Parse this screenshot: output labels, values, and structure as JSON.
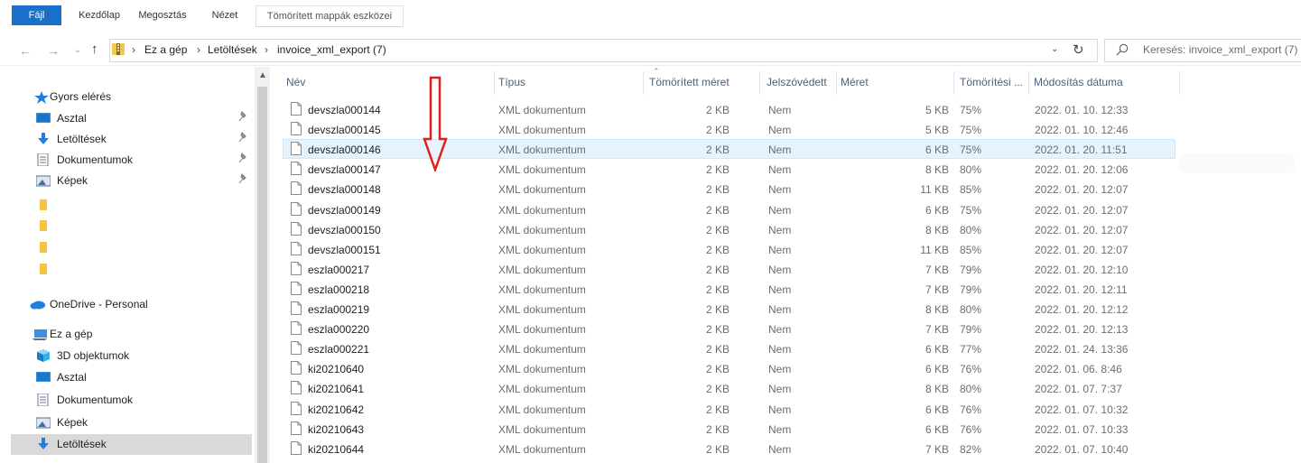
{
  "ribbon": {
    "tabs": [
      "Fájl",
      "Kezdőlap",
      "Megosztás",
      "Nézet"
    ],
    "context_tab": "Tömörített mappák eszközei",
    "file_tab_color": "#1a6fc9"
  },
  "address": {
    "crumbs": [
      "Ez a gép",
      "Letöltések",
      "invoice_xml_export (7)"
    ],
    "search_placeholder": "Keresés: invoice_xml_export (7)"
  },
  "nav": {
    "quick_access": "Gyors elérés",
    "items": [
      {
        "label": "Asztal",
        "icon": "desktop-icon",
        "pinned": true
      },
      {
        "label": "Letöltések",
        "icon": "download-icon",
        "pinned": true
      },
      {
        "label": "Dokumentumok",
        "icon": "documents-icon",
        "pinned": true
      },
      {
        "label": "Képek",
        "icon": "pictures-icon",
        "pinned": true
      },
      {
        "label": "",
        "icon": "folder-icon"
      },
      {
        "label": "",
        "icon": "folder-icon"
      },
      {
        "label": "",
        "icon": "folder-icon"
      },
      {
        "label": "",
        "icon": "folder-icon"
      }
    ],
    "onedrive": "OneDrive - Personal",
    "this_pc": "Ez a gép",
    "pc_items": [
      {
        "label": "3D objektumok",
        "icon": "3d-objects-icon"
      },
      {
        "label": "Asztal",
        "icon": "desktop-icon"
      },
      {
        "label": "Dokumentumok",
        "icon": "documents-icon"
      },
      {
        "label": "Képek",
        "icon": "pictures-icon"
      },
      {
        "label": "Letöltések",
        "icon": "download-icon",
        "selected": true
      }
    ]
  },
  "columns": {
    "name": "Név",
    "type": "Típus",
    "compressed_size": "Tömörített méret",
    "password": "Jelszóvédett",
    "size": "Méret",
    "ratio": "Tömörítési ...",
    "date": "Módosítás dátuma"
  },
  "files": [
    {
      "name": "devszla000144",
      "type": "XML dokumentum",
      "csize": "2 KB",
      "pw": "Nem",
      "size": "5 KB",
      "ratio": "75%",
      "date": "2022. 01. 10. 12:33"
    },
    {
      "name": "devszla000145",
      "type": "XML dokumentum",
      "csize": "2 KB",
      "pw": "Nem",
      "size": "5 KB",
      "ratio": "75%",
      "date": "2022. 01. 10. 12:46"
    },
    {
      "name": "devszla000146",
      "type": "XML dokumentum",
      "csize": "2 KB",
      "pw": "Nem",
      "size": "6 KB",
      "ratio": "75%",
      "date": "2022. 01. 20. 11:51",
      "hover": true
    },
    {
      "name": "devszla000147",
      "type": "XML dokumentum",
      "csize": "2 KB",
      "pw": "Nem",
      "size": "8 KB",
      "ratio": "80%",
      "date": "2022. 01. 20. 12:06"
    },
    {
      "name": "devszla000148",
      "type": "XML dokumentum",
      "csize": "2 KB",
      "pw": "Nem",
      "size": "11 KB",
      "ratio": "85%",
      "date": "2022. 01. 20. 12:07"
    },
    {
      "name": "devszla000149",
      "type": "XML dokumentum",
      "csize": "2 KB",
      "pw": "Nem",
      "size": "6 KB",
      "ratio": "75%",
      "date": "2022. 01. 20. 12:07"
    },
    {
      "name": "devszla000150",
      "type": "XML dokumentum",
      "csize": "2 KB",
      "pw": "Nem",
      "size": "8 KB",
      "ratio": "80%",
      "date": "2022. 01. 20. 12:07"
    },
    {
      "name": "devszla000151",
      "type": "XML dokumentum",
      "csize": "2 KB",
      "pw": "Nem",
      "size": "11 KB",
      "ratio": "85%",
      "date": "2022. 01. 20. 12:07"
    },
    {
      "name": "eszla000217",
      "type": "XML dokumentum",
      "csize": "2 KB",
      "pw": "Nem",
      "size": "7 KB",
      "ratio": "79%",
      "date": "2022. 01. 20. 12:10"
    },
    {
      "name": "eszla000218",
      "type": "XML dokumentum",
      "csize": "2 KB",
      "pw": "Nem",
      "size": "7 KB",
      "ratio": "79%",
      "date": "2022. 01. 20. 12:11"
    },
    {
      "name": "eszla000219",
      "type": "XML dokumentum",
      "csize": "2 KB",
      "pw": "Nem",
      "size": "8 KB",
      "ratio": "80%",
      "date": "2022. 01. 20. 12:12"
    },
    {
      "name": "eszla000220",
      "type": "XML dokumentum",
      "csize": "2 KB",
      "pw": "Nem",
      "size": "7 KB",
      "ratio": "79%",
      "date": "2022. 01. 20. 12:13"
    },
    {
      "name": "eszla000221",
      "type": "XML dokumentum",
      "csize": "2 KB",
      "pw": "Nem",
      "size": "6 KB",
      "ratio": "77%",
      "date": "2022. 01. 24. 13:36"
    },
    {
      "name": "ki20210640",
      "type": "XML dokumentum",
      "csize": "2 KB",
      "pw": "Nem",
      "size": "6 KB",
      "ratio": "76%",
      "date": "2022. 01. 06. 8:46"
    },
    {
      "name": "ki20210641",
      "type": "XML dokumentum",
      "csize": "2 KB",
      "pw": "Nem",
      "size": "8 KB",
      "ratio": "80%",
      "date": "2022. 01. 07. 7:37"
    },
    {
      "name": "ki20210642",
      "type": "XML dokumentum",
      "csize": "2 KB",
      "pw": "Nem",
      "size": "6 KB",
      "ratio": "76%",
      "date": "2022. 01. 07. 10:32"
    },
    {
      "name": "ki20210643",
      "type": "XML dokumentum",
      "csize": "2 KB",
      "pw": "Nem",
      "size": "6 KB",
      "ratio": "76%",
      "date": "2022. 01. 07. 10:33"
    },
    {
      "name": "ki20210644",
      "type": "XML dokumentum",
      "csize": "2 KB",
      "pw": "Nem",
      "size": "7 KB",
      "ratio": "82%",
      "date": "2022. 01. 07. 10:40"
    }
  ],
  "annotation_color": "#e0201e"
}
